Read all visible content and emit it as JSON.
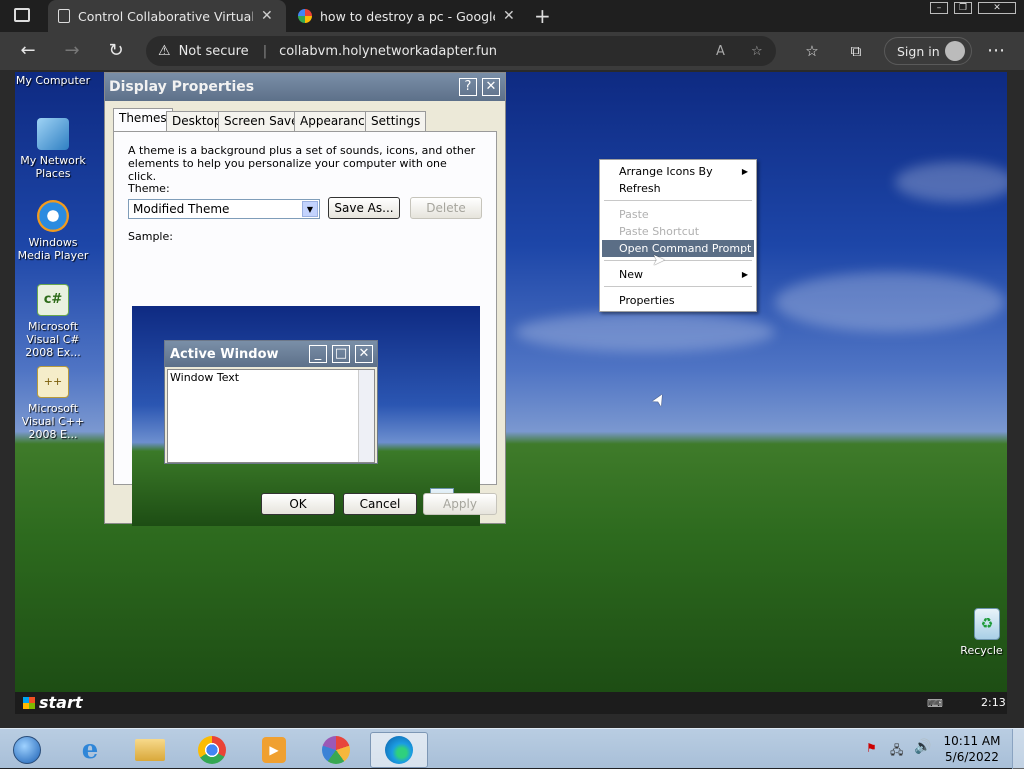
{
  "browser": {
    "tabs": [
      {
        "title": "Control Collaborative Virtual Ma",
        "active": true
      },
      {
        "title": "how to destroy a pc - Google Se",
        "active": false
      }
    ],
    "security_label": "Not secure",
    "url": "collabvm.holynetworkadapter.fun",
    "signin_label": "Sign in"
  },
  "desktop": {
    "icons": [
      {
        "label": "My Computer"
      },
      {
        "label": "My Network Places"
      },
      {
        "label": "Windows Media Player"
      },
      {
        "label": "Microsoft Visual C# 2008 Ex..."
      },
      {
        "label": "Microsoft Visual C++ 2008 E..."
      },
      {
        "label": "Recycle B"
      }
    ]
  },
  "dialog": {
    "title": "Display Properties",
    "tabs": [
      "Themes",
      "Desktop",
      "Screen Saver",
      "Appearance",
      "Settings"
    ],
    "selected_tab": "Themes",
    "description": "A theme is a background plus a set of sounds, icons, and other elements to help you personalize your computer with one click.",
    "theme_label": "Theme:",
    "theme_value": "Modified Theme",
    "save_as": "Save As...",
    "delete": "Delete",
    "sample_label": "Sample:",
    "sample_window_title": "Active Window",
    "sample_window_text": "Window Text",
    "ok": "OK",
    "cancel": "Cancel",
    "apply": "Apply"
  },
  "context_menu": {
    "items": [
      {
        "label": "Arrange Icons By",
        "submenu": true,
        "enabled": true
      },
      {
        "label": "Refresh",
        "enabled": true
      },
      {
        "label": "Paste",
        "enabled": false
      },
      {
        "label": "Paste Shortcut",
        "enabled": false
      },
      {
        "label": "Open Command Prompt",
        "enabled": true,
        "highlighted": true
      },
      {
        "label": "New",
        "submenu": true,
        "enabled": true
      },
      {
        "label": "Properties",
        "enabled": true
      }
    ]
  },
  "vm_taskbar": {
    "start_label": "start",
    "clock": "2:13"
  },
  "host_taskbar": {
    "time": "10:11 AM",
    "date": "5/6/2022"
  },
  "colors": {
    "highlight": "#5b6e86",
    "xp_title": "#5d7089"
  }
}
